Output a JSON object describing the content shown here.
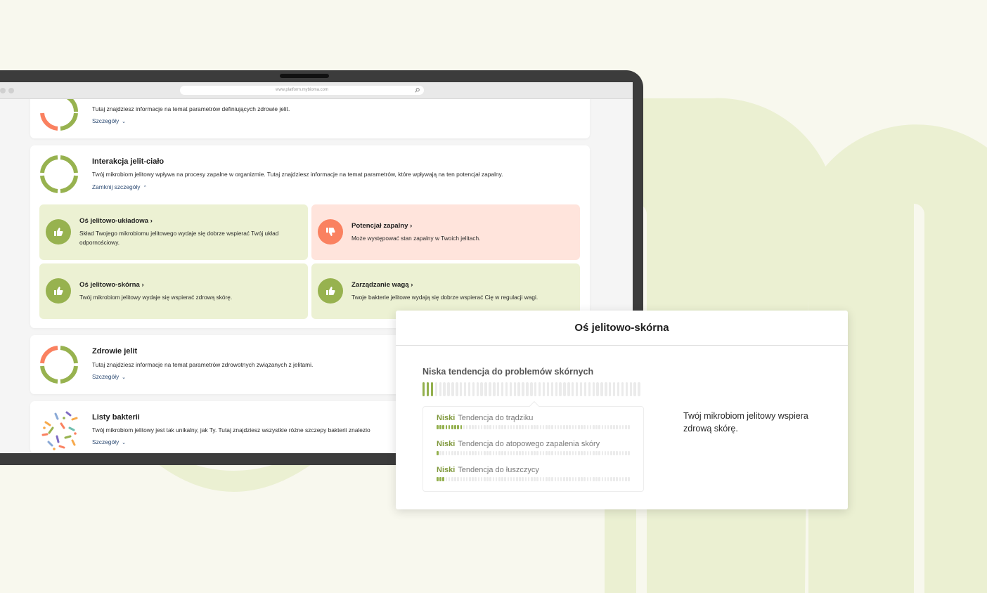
{
  "browser": {
    "url": "www.platform.mybioma.com"
  },
  "colors": {
    "accent_green": "#97b24f",
    "accent_orange": "#fa8160",
    "tile_good_bg": "#ecf1d3",
    "tile_bad_bg": "#ffe4dc",
    "link_blue": "#2d4b73"
  },
  "sections": [
    {
      "title": "",
      "description": "Tutaj znajdziesz informacje na temat parametrów definiujących zdrowie jelit.",
      "link": "Szczegóły",
      "ring": "orange-green-ring-icon"
    },
    {
      "title": "Interakcja jelit-ciało",
      "description": "Twój mikrobiom jelitowy wpływa na procesy zapalne w organizmie. Tutaj znajdziesz informacje na temat parametrów, które wpływają na ten potencjał zapalny.",
      "link": "Zamknij szczegóły",
      "ring": "green-ring-icon"
    },
    {
      "title": "Zdrowie jelit",
      "description": "Tutaj znajdziesz informacje na temat parametrów zdrowotnych związanych z jelitami.",
      "link": "Szczegóły",
      "ring": "orange-green-ring-icon"
    },
    {
      "title": "Listy bakterii",
      "description": "Twój mikrobiom jelitowy jest tak unikalny, jak Ty. Tutaj znajdziesz wszystkie różne szczepy bakterii znalezio",
      "link": "Szczegóły",
      "ring": "bacteria-illustration-icon"
    }
  ],
  "tiles": [
    {
      "title": "Oś jelitowo-układowa",
      "description": "Skład Twojego mikrobiomu jelitowego wydaje się dobrze wspierać Twój układ odpornościowy.",
      "status": "good",
      "icon": "thumbs-up-icon"
    },
    {
      "title": "Potencjał zapalny",
      "description": "Może występować stan zapalny w Twoich jelitach.",
      "status": "bad",
      "icon": "thumbs-down-icon"
    },
    {
      "title": "Oś jelitowo-skórna",
      "description": "Twój mikrobiom jelitowy wydaje się wspierać zdrową skórę.",
      "status": "good",
      "icon": "thumbs-up-icon"
    },
    {
      "title": "Zarządzanie wagą",
      "description": "Twoje bakterie jelitowe wydają się dobrze wspierać Cię w regulacji wagi.",
      "status": "good",
      "icon": "thumbs-up-icon"
    }
  ],
  "modal": {
    "title": "Oś jelitowo-skórna",
    "subtitle": "Niska tendencja do problemów skórnych",
    "main_score_fraction": 0.06,
    "note": "Twój mikrobiom jelitowy wspiera zdrową skórę.",
    "details": [
      {
        "level": "Niski",
        "label": "Tendencja do trądziku",
        "score_fraction": 0.14
      },
      {
        "level": "Niski",
        "label": "Tendencja do atopowego zapalenia skóry",
        "score_fraction": 0.02
      },
      {
        "level": "Niski",
        "label": "Tendencja do łuszczycy",
        "score_fraction": 0.04
      }
    ]
  }
}
